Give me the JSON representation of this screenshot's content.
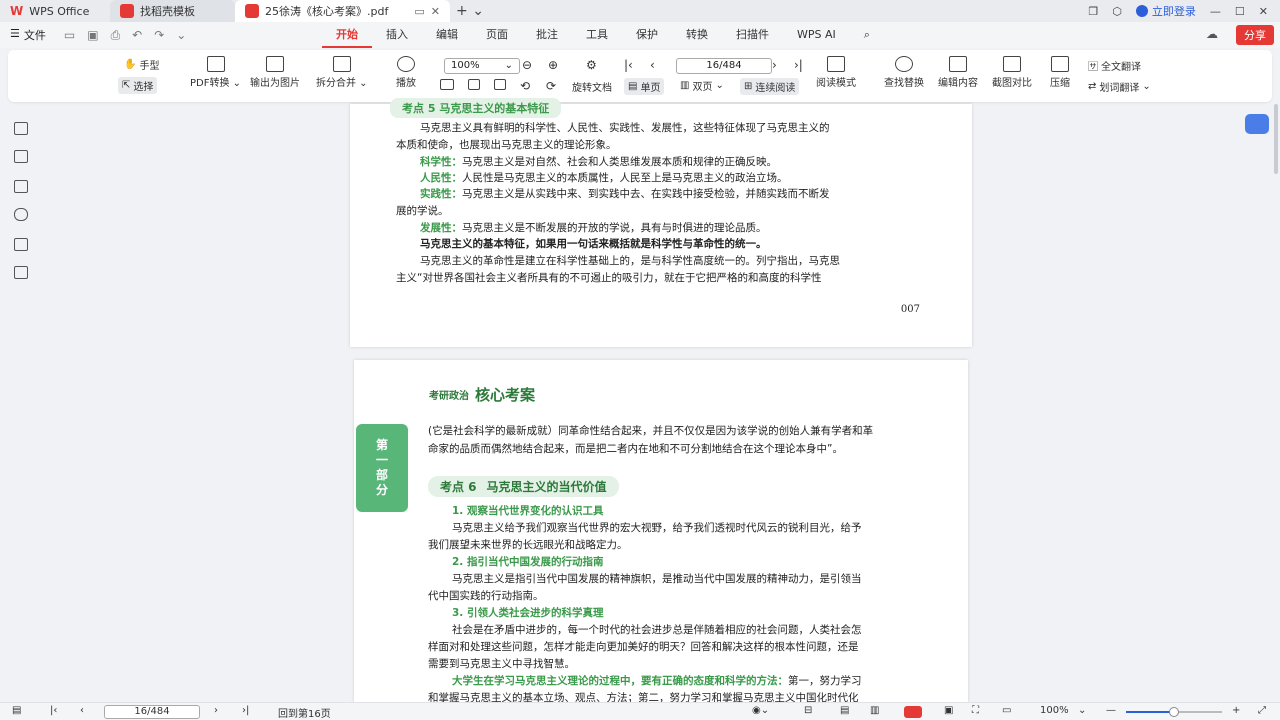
{
  "titlebar": {
    "app_name": "WPS Office",
    "tabs": [
      {
        "label": "找稻壳模板"
      },
      {
        "label": "25徐涛《核心考案》.pdf"
      }
    ],
    "login": "立即登录"
  },
  "menubar": {
    "file": "文件",
    "tabs": [
      "开始",
      "插入",
      "编辑",
      "页面",
      "批注",
      "工具",
      "保护",
      "转换",
      "扫描件",
      "WPS AI"
    ],
    "active_tab": "开始",
    "share": "分享"
  },
  "ribbon": {
    "hand": "手型",
    "select": "选择",
    "pdf_convert": "PDF转换",
    "export_image": "输出为图片",
    "split_merge": "拆分合并",
    "play": "播放",
    "zoom": "100%",
    "page": "16/484",
    "rotate": "旋转文档",
    "single": "单页",
    "double": "双页",
    "continuous": "连续阅读",
    "read_mode": "阅读模式",
    "find_replace": "查找替换",
    "edit_content": "编辑内容",
    "screenshot_compare": "截图对比",
    "compress": "压缩",
    "full_translate": "全文翻译",
    "word_translate": "划词翻译"
  },
  "page1": {
    "section_title": "考点 5  马克思主义的基本特征",
    "lines": [
      "马克思主义具有鲜明的科学性、人民性、实践性、发展性，这些特征体现了马克思主义的",
      "本质和使命，也展现出马克思主义的理论形象。"
    ],
    "items": [
      {
        "term": "科学性：",
        "text": "马克思主义是对自然、社会和人类思维发展本质和规律的正确反映。"
      },
      {
        "term": "人民性：",
        "text": "人民性是马克思主义的本质属性，人民至上是马克思主义的政治立场。"
      },
      {
        "term": "实践性：",
        "text": "马克思主义是从实践中来、到实践中去、在实践中接受检验，并随实践而不断发"
      },
      {
        "term": "",
        "text": "展的学说。"
      },
      {
        "term": "发展性：",
        "text": "马克思主义是不断发展的开放的学说，具有与时俱进的理论品质。"
      }
    ],
    "bold_line": "马克思主义的基本特征，如果用一句话来概括就是科学性与革命性的统一。",
    "tail": [
      "马克思主义的革命性是建立在科学性基础上的，是与科学性高度统一的。列宁指出，马克思",
      "主义“对世界各国社会主义者所具有的不可遏止的吸引力，就在于它把严格的和高度的科学性"
    ],
    "page_number": "007"
  },
  "page2": {
    "header_small": "考研政治",
    "header_big": "核心考案",
    "side_tab": [
      "第",
      "一",
      "部",
      "分"
    ],
    "intro": [
      "(它是社会科学的最新成就）同革命性结合起来，并且不仅仅是因为该学说的创始人兼有学者和革",
      "命家的品质而偶然地结合起来，而是把二者内在地和不可分割地结合在这个理论本身中”。"
    ],
    "kp_num": "考点 6",
    "kp_title": "马克思主义的当代价值",
    "sections": [
      {
        "title": "1. 观察当代世界变化的认识工具",
        "lines": [
          "马克思主义给予我们观察当代世界的宏大视野，给予我们透视时代风云的锐利目光，给予",
          "我们展望未来世界的长远眼光和战略定力。"
        ]
      },
      {
        "title": "2. 指引当代中国发展的行动指南",
        "lines": [
          "马克思主义是指引当代中国发展的精神旗帜，是推动当代中国发展的精神动力，是引领当",
          "代中国实践的行动指南。"
        ]
      },
      {
        "title": "3. 引领人类社会进步的科学真理",
        "lines": [
          "社会是在矛盾中进步的，每一个时代的社会进步总是伴随着相应的社会问题，人类社会怎",
          "样面对和处理这些问题，怎样才能走向更加美好的明天？回答和解决这样的根本性问题，还是",
          "需要到马克思主义中寻找智慧。"
        ]
      }
    ],
    "last_bold": "大学生在学习马克思主义理论的过程中，要有正确的态度和科学的方法：",
    "last_rest": "第一，努力学习",
    "last_line": "和掌握马克思主义的基本立场、观点、方法；第二，努力学习和掌握马克思主义中国化时代化"
  },
  "statusbar": {
    "page": "16/484",
    "goto": "回到第16页",
    "zoom": "100%",
    "zoom_level": 0.5
  }
}
